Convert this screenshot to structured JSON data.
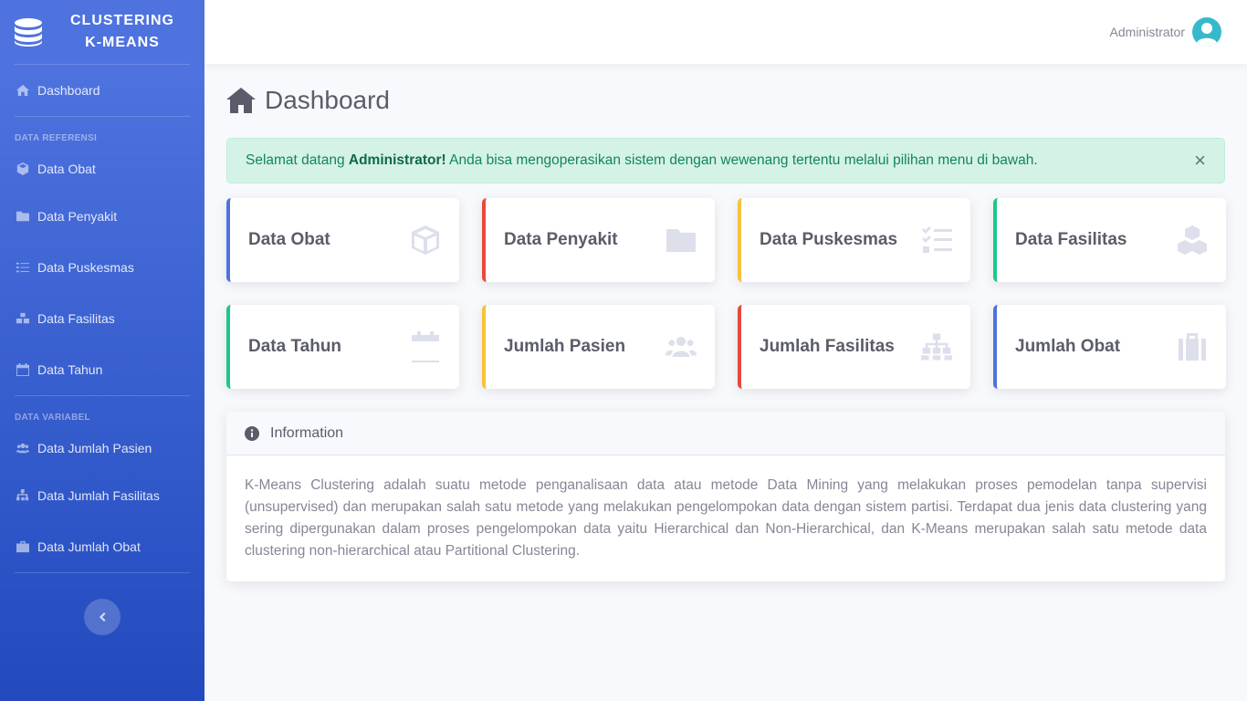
{
  "brand": {
    "line1": "CLUSTERING",
    "line2": "K-MEANS"
  },
  "sidebar": {
    "dashboard": "Dashboard",
    "heading_ref": "DATA REFERENSI",
    "ref_items": [
      {
        "label": "Data Obat",
        "icon": "cube-icon"
      },
      {
        "label": "Data Penyakit",
        "icon": "folder-icon"
      },
      {
        "label": "Data Puskesmas",
        "icon": "tasks-icon"
      },
      {
        "label": "Data Fasilitas",
        "icon": "cubes-icon"
      },
      {
        "label": "Data Tahun",
        "icon": "calendar-icon"
      }
    ],
    "heading_var": "DATA VARIABEL",
    "var_items": [
      {
        "label": "Data Jumlah Pasien",
        "icon": "users-icon"
      },
      {
        "label": "Data Jumlah Fasilitas",
        "icon": "sitemap-icon"
      },
      {
        "label": "Data Jumlah Obat",
        "icon": "briefcase-icon"
      }
    ]
  },
  "topbar": {
    "user": "Administrator"
  },
  "page": {
    "title": "Dashboard"
  },
  "alert": {
    "prefix": "Selamat datang ",
    "name": "Administrator!",
    "suffix": " Anda bisa mengoperasikan sistem dengan wewenang tertentu melalui pilihan menu di bawah.",
    "close": "×"
  },
  "cards": [
    {
      "label": "Data Obat",
      "color": "#4e73df",
      "icon": "cube-icon"
    },
    {
      "label": "Data Penyakit",
      "color": "#e74a3b",
      "icon": "folder-icon"
    },
    {
      "label": "Data Puskesmas",
      "color": "#f6c23e",
      "icon": "tasks-icon"
    },
    {
      "label": "Data Fasilitas",
      "color": "#1cc88a",
      "icon": "cubes-icon"
    },
    {
      "label": "Data Tahun",
      "color": "#1cc88a",
      "icon": "calendar-icon"
    },
    {
      "label": "Jumlah Pasien",
      "color": "#f6c23e",
      "icon": "users-icon"
    },
    {
      "label": "Jumlah Fasilitas",
      "color": "#e74a3b",
      "icon": "sitemap-icon"
    },
    {
      "label": "Jumlah Obat",
      "color": "#4e73df",
      "icon": "briefcase-icon"
    }
  ],
  "info": {
    "title": "Information",
    "body": "K-Means Clustering adalah suatu metode penganalisaan data atau metode Data Mining yang melakukan proses pemodelan tanpa supervisi (unsupervised) dan merupakan salah satu metode yang melakukan pengelompokan data dengan sistem partisi. Terdapat dua jenis data clustering yang sering dipergunakan dalam proses pengelompokan data yaitu Hierarchical dan Non-Hierarchical, dan K-Means merupakan salah satu metode data clustering non-hierarchical atau Partitional Clustering."
  }
}
